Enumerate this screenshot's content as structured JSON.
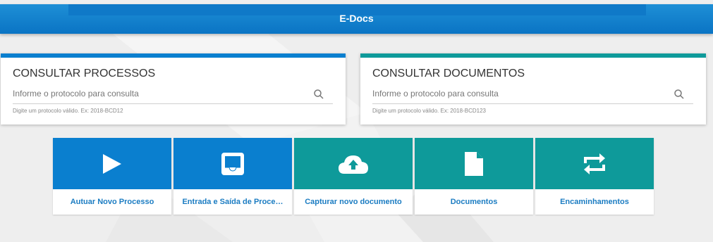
{
  "header": {
    "title": "E-Docs"
  },
  "colors": {
    "blue": "#0a7fcf",
    "teal": "#0e9a9a",
    "label": "#1b7cc2"
  },
  "search_processos": {
    "title": "CONSULTAR PROCESSOS",
    "placeholder": "Informe o protocolo para consulta",
    "hint": "Digite um protocolo válido. Ex: 2018-BCD12"
  },
  "search_documentos": {
    "title": "CONSULTAR DOCUMENTOS",
    "placeholder": "Informe o protocolo para consulta",
    "hint": "Digite um protocolo válido. Ex: 2018-BCD123"
  },
  "tiles": [
    {
      "label": "Autuar Novo Processo",
      "icon": "play-icon"
    },
    {
      "label": "Entrada e Saída de Proce…",
      "icon": "inbox-icon"
    },
    {
      "label": "Capturar novo documento",
      "icon": "cloud-upload-icon"
    },
    {
      "label": "Documentos",
      "icon": "document-icon"
    },
    {
      "label": "Encaminhamentos",
      "icon": "repeat-icon"
    }
  ]
}
